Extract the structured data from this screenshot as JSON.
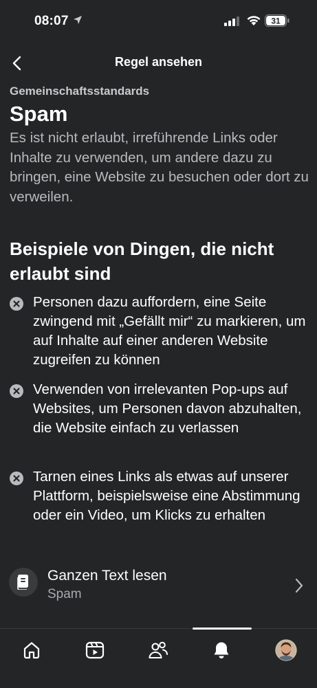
{
  "status_bar": {
    "time": "08:07",
    "battery": "31"
  },
  "nav": {
    "title": "Regel ansehen"
  },
  "section_label": "Gemeinschaftsstandards",
  "rule": {
    "title": "Spam",
    "description": "Es ist nicht erlaubt, irreführende Links oder Inhalte zu verwenden, um andere dazu zu bringen, eine Website zu besuchen oder dort zu verweilen."
  },
  "examples": {
    "heading": "Beispiele von Dingen, die nicht erlaubt sind",
    "items": [
      {
        "text": "Personen dazu auffordern, eine Seite zwingend mit „Gefällt mir“ zu markieren, um auf Inhalte auf einer anderen Website zugreifen zu können"
      },
      {
        "text": "Verwenden von irrelevanten Pop-ups auf Websites, um Personen davon abzuhalten, die Website einfach zu verlassen"
      },
      {
        "text": "Tarnen eines Links als etwas auf unserer Plattform, beispielsweise eine Abstimmung oder ein Video, um Klicks zu erhalten"
      }
    ]
  },
  "read_full": {
    "title": "Ganzen Text lesen",
    "subtitle": "Spam"
  },
  "tabs": [
    {
      "icon": "home-icon"
    },
    {
      "icon": "video-icon"
    },
    {
      "icon": "friends-icon"
    },
    {
      "icon": "bell-icon",
      "active": true
    },
    {
      "icon": "profile-avatar"
    }
  ],
  "colors": {
    "background": "#242526",
    "text": "#ffffff",
    "secondary_text": "#b8babe"
  }
}
